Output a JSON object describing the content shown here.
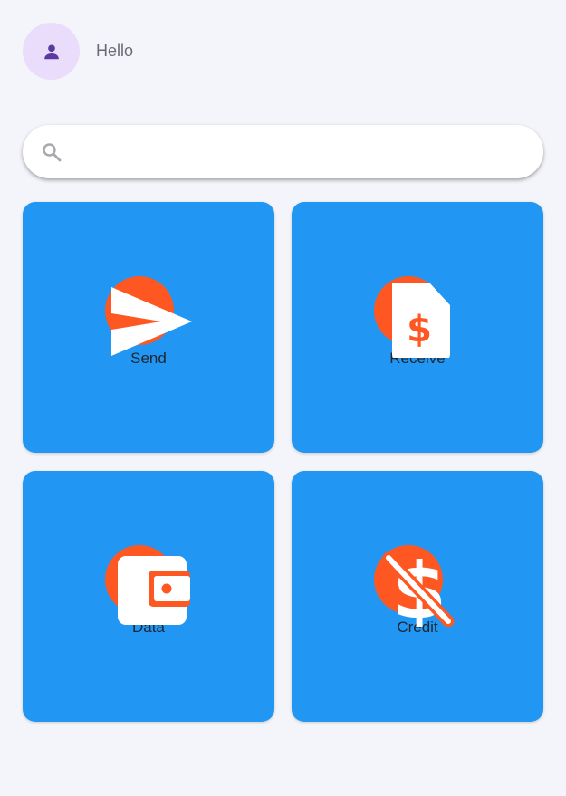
{
  "header": {
    "greeting": "Hello",
    "avatar_icon": "person-icon"
  },
  "search": {
    "placeholder": "",
    "value": "",
    "icon": "search-icon"
  },
  "tiles": [
    {
      "label": "Send",
      "icon": "send-icon"
    },
    {
      "label": "Receive",
      "icon": "receipt-dollar-icon"
    },
    {
      "label": "Data",
      "icon": "wallet-icon"
    },
    {
      "label": "Crédit",
      "icon": "money-off-icon"
    }
  ],
  "colors": {
    "background": "#f4f5fa",
    "tile": "#2196f3",
    "accent": "#ff5722",
    "avatar_bg": "#eadcfb",
    "avatar_fg": "#5b3a9e"
  }
}
